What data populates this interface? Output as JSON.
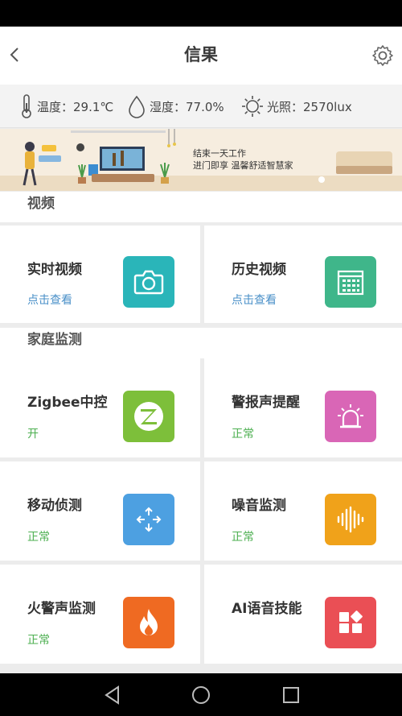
{
  "header": {
    "title": "信果"
  },
  "environment": {
    "temperature": "温度：29.1℃",
    "humidity": "湿度：77.0%",
    "light": "光照：2570lux"
  },
  "banner": {
    "line1": "结束一天工作",
    "line2": "进门即享 温馨舒适智慧家"
  },
  "sections": {
    "video": "视频",
    "home_monitor": "家庭监测"
  },
  "cards": [
    {
      "label": "实时视频",
      "status": "点击查看",
      "icon": "camera-icon"
    },
    {
      "label": "历史视频",
      "status": "点击查看",
      "icon": "calendar-icon"
    },
    {
      "label": "Zigbee中控",
      "status": "开",
      "icon": "zigbee-icon"
    },
    {
      "label": "警报声提醒",
      "status": "正常",
      "icon": "alarm-light-icon"
    },
    {
      "label": "移动侦测",
      "status": "正常",
      "icon": "move-arrows-icon"
    },
    {
      "label": "噪音监测",
      "status": "正常",
      "icon": "sound-wave-icon"
    },
    {
      "label": "火警声监测",
      "status": "正常",
      "icon": "fire-icon"
    },
    {
      "label": "AI语音技能",
      "status": "",
      "icon": "apps-icon"
    }
  ],
  "colors": {
    "camera": "#2ab5b9",
    "calendar": "#3fb68a",
    "zigbee": "#7dbf3a",
    "alarm": "#d966b6",
    "move": "#4da0e1",
    "sound": "#f0a21a",
    "fire": "#ef6a22",
    "apps": "#ea4f55",
    "link_blue": "#4a90c8",
    "status_green": "#4caf50"
  }
}
